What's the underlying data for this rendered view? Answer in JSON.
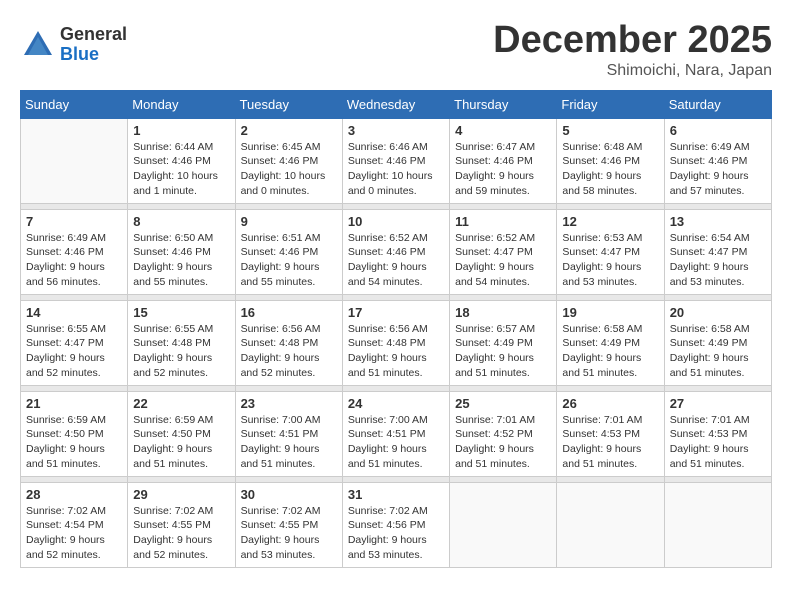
{
  "logo": {
    "general": "General",
    "blue": "Blue"
  },
  "title": {
    "month": "December 2025",
    "location": "Shimoichi, Nara, Japan"
  },
  "weekdays": [
    "Sunday",
    "Monday",
    "Tuesday",
    "Wednesday",
    "Thursday",
    "Friday",
    "Saturday"
  ],
  "weeks": [
    [
      {
        "day": "",
        "info": ""
      },
      {
        "day": "1",
        "info": "Sunrise: 6:44 AM\nSunset: 4:46 PM\nDaylight: 10 hours\nand 1 minute."
      },
      {
        "day": "2",
        "info": "Sunrise: 6:45 AM\nSunset: 4:46 PM\nDaylight: 10 hours\nand 0 minutes."
      },
      {
        "day": "3",
        "info": "Sunrise: 6:46 AM\nSunset: 4:46 PM\nDaylight: 10 hours\nand 0 minutes."
      },
      {
        "day": "4",
        "info": "Sunrise: 6:47 AM\nSunset: 4:46 PM\nDaylight: 9 hours\nand 59 minutes."
      },
      {
        "day": "5",
        "info": "Sunrise: 6:48 AM\nSunset: 4:46 PM\nDaylight: 9 hours\nand 58 minutes."
      },
      {
        "day": "6",
        "info": "Sunrise: 6:49 AM\nSunset: 4:46 PM\nDaylight: 9 hours\nand 57 minutes."
      }
    ],
    [
      {
        "day": "7",
        "info": "Sunrise: 6:49 AM\nSunset: 4:46 PM\nDaylight: 9 hours\nand 56 minutes."
      },
      {
        "day": "8",
        "info": "Sunrise: 6:50 AM\nSunset: 4:46 PM\nDaylight: 9 hours\nand 55 minutes."
      },
      {
        "day": "9",
        "info": "Sunrise: 6:51 AM\nSunset: 4:46 PM\nDaylight: 9 hours\nand 55 minutes."
      },
      {
        "day": "10",
        "info": "Sunrise: 6:52 AM\nSunset: 4:46 PM\nDaylight: 9 hours\nand 54 minutes."
      },
      {
        "day": "11",
        "info": "Sunrise: 6:52 AM\nSunset: 4:47 PM\nDaylight: 9 hours\nand 54 minutes."
      },
      {
        "day": "12",
        "info": "Sunrise: 6:53 AM\nSunset: 4:47 PM\nDaylight: 9 hours\nand 53 minutes."
      },
      {
        "day": "13",
        "info": "Sunrise: 6:54 AM\nSunset: 4:47 PM\nDaylight: 9 hours\nand 53 minutes."
      }
    ],
    [
      {
        "day": "14",
        "info": "Sunrise: 6:55 AM\nSunset: 4:47 PM\nDaylight: 9 hours\nand 52 minutes."
      },
      {
        "day": "15",
        "info": "Sunrise: 6:55 AM\nSunset: 4:48 PM\nDaylight: 9 hours\nand 52 minutes."
      },
      {
        "day": "16",
        "info": "Sunrise: 6:56 AM\nSunset: 4:48 PM\nDaylight: 9 hours\nand 52 minutes."
      },
      {
        "day": "17",
        "info": "Sunrise: 6:56 AM\nSunset: 4:48 PM\nDaylight: 9 hours\nand 51 minutes."
      },
      {
        "day": "18",
        "info": "Sunrise: 6:57 AM\nSunset: 4:49 PM\nDaylight: 9 hours\nand 51 minutes."
      },
      {
        "day": "19",
        "info": "Sunrise: 6:58 AM\nSunset: 4:49 PM\nDaylight: 9 hours\nand 51 minutes."
      },
      {
        "day": "20",
        "info": "Sunrise: 6:58 AM\nSunset: 4:49 PM\nDaylight: 9 hours\nand 51 minutes."
      }
    ],
    [
      {
        "day": "21",
        "info": "Sunrise: 6:59 AM\nSunset: 4:50 PM\nDaylight: 9 hours\nand 51 minutes."
      },
      {
        "day": "22",
        "info": "Sunrise: 6:59 AM\nSunset: 4:50 PM\nDaylight: 9 hours\nand 51 minutes."
      },
      {
        "day": "23",
        "info": "Sunrise: 7:00 AM\nSunset: 4:51 PM\nDaylight: 9 hours\nand 51 minutes."
      },
      {
        "day": "24",
        "info": "Sunrise: 7:00 AM\nSunset: 4:51 PM\nDaylight: 9 hours\nand 51 minutes."
      },
      {
        "day": "25",
        "info": "Sunrise: 7:01 AM\nSunset: 4:52 PM\nDaylight: 9 hours\nand 51 minutes."
      },
      {
        "day": "26",
        "info": "Sunrise: 7:01 AM\nSunset: 4:53 PM\nDaylight: 9 hours\nand 51 minutes."
      },
      {
        "day": "27",
        "info": "Sunrise: 7:01 AM\nSunset: 4:53 PM\nDaylight: 9 hours\nand 51 minutes."
      }
    ],
    [
      {
        "day": "28",
        "info": "Sunrise: 7:02 AM\nSunset: 4:54 PM\nDaylight: 9 hours\nand 52 minutes."
      },
      {
        "day": "29",
        "info": "Sunrise: 7:02 AM\nSunset: 4:55 PM\nDaylight: 9 hours\nand 52 minutes."
      },
      {
        "day": "30",
        "info": "Sunrise: 7:02 AM\nSunset: 4:55 PM\nDaylight: 9 hours\nand 53 minutes."
      },
      {
        "day": "31",
        "info": "Sunrise: 7:02 AM\nSunset: 4:56 PM\nDaylight: 9 hours\nand 53 minutes."
      },
      {
        "day": "",
        "info": ""
      },
      {
        "day": "",
        "info": ""
      },
      {
        "day": "",
        "info": ""
      }
    ]
  ]
}
